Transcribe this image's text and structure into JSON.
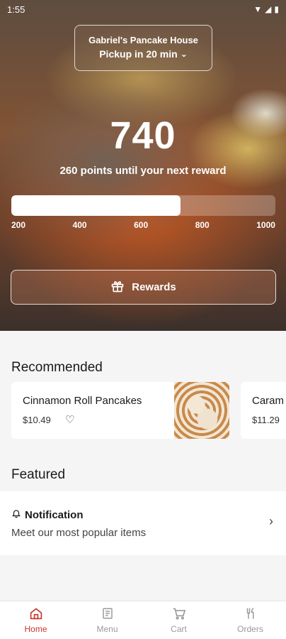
{
  "status_bar": {
    "time": "1:55"
  },
  "store": {
    "name": "Gabriel's Pancake House",
    "pickup": "Pickup in 20 min"
  },
  "rewards": {
    "points": "740",
    "subtitle": "260 points until your next reward",
    "progress_fraction": 0.64,
    "ticks": [
      "200",
      "400",
      "600",
      "800",
      "1000"
    ],
    "button_label": "Rewards"
  },
  "recommended": {
    "title": "Recommended",
    "items": [
      {
        "name": "Cinnamon Roll Pancakes",
        "price": "$10.49"
      },
      {
        "name": "Caram",
        "price": "$11.29"
      }
    ]
  },
  "featured": {
    "title": "Featured",
    "notification_title": "Notification",
    "notification_sub": "Meet our most popular items"
  },
  "nav": {
    "items": [
      {
        "label": "Home",
        "active": true
      },
      {
        "label": "Menu"
      },
      {
        "label": "Cart"
      },
      {
        "label": "Orders"
      }
    ]
  },
  "colors": {
    "accent": "#c8362c"
  }
}
